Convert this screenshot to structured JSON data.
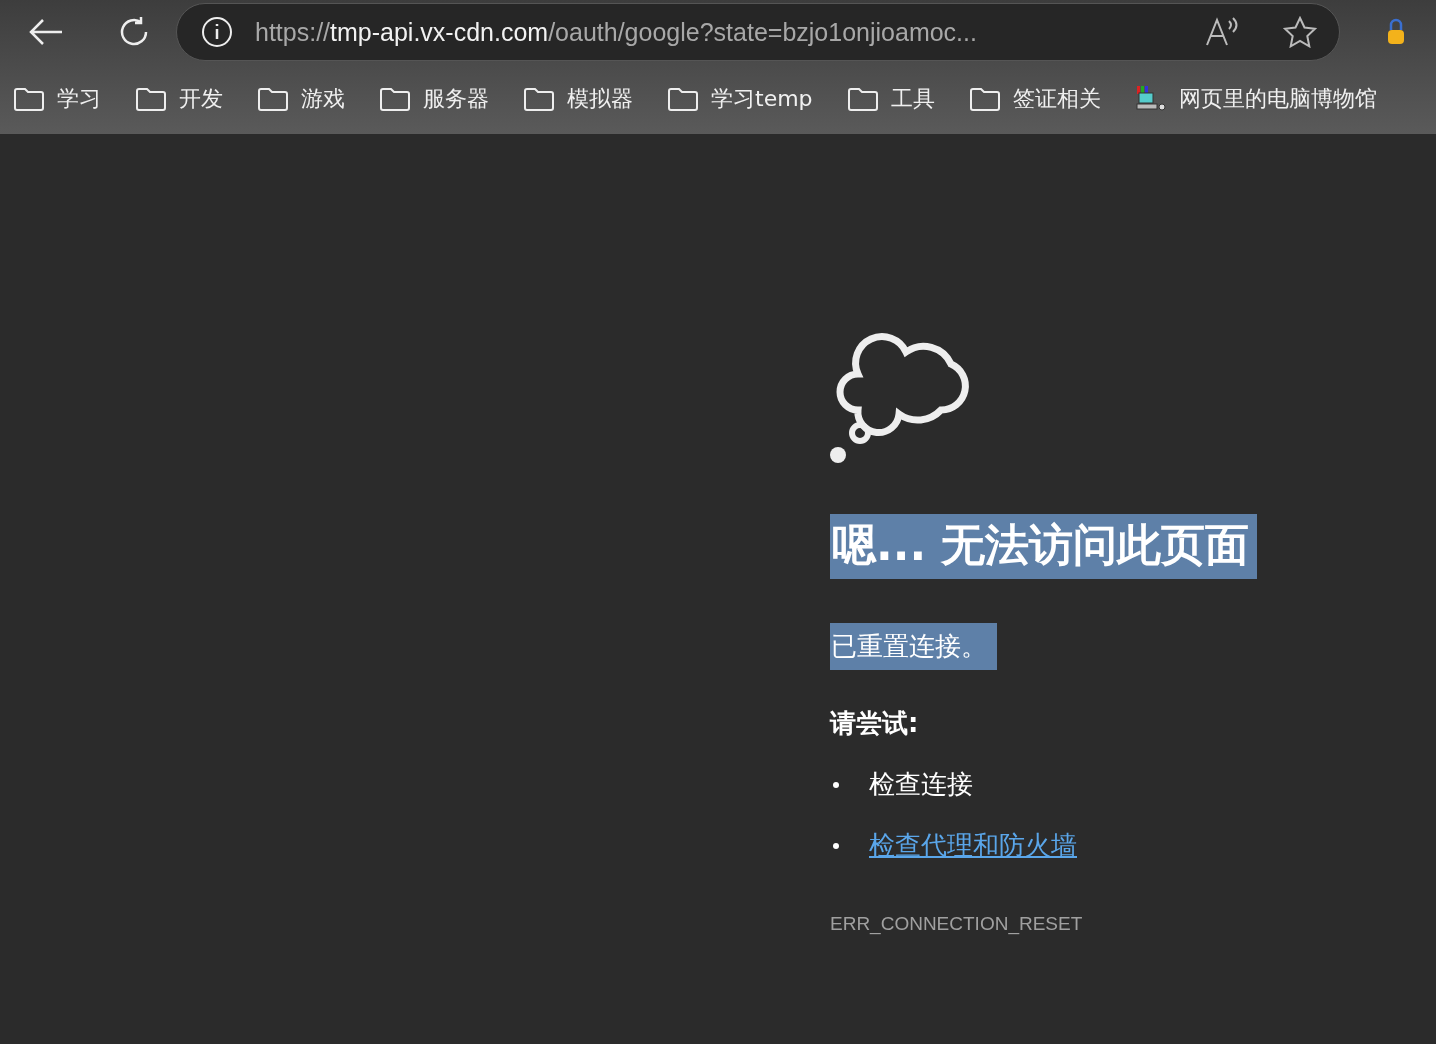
{
  "address": {
    "scheme": "https://",
    "host": "tmp-api.vx-cdn.com",
    "path": "/oauth/google?state=bzjo1onjioamoc..."
  },
  "bookmarks": [
    {
      "kind": "folder",
      "label": "学习"
    },
    {
      "kind": "folder",
      "label": "开发"
    },
    {
      "kind": "folder",
      "label": "游戏"
    },
    {
      "kind": "folder",
      "label": "服务器"
    },
    {
      "kind": "folder",
      "label": "模拟器"
    },
    {
      "kind": "folder",
      "label": "学习temp"
    },
    {
      "kind": "folder",
      "label": "工具"
    },
    {
      "kind": "folder",
      "label": "签证相关"
    },
    {
      "kind": "site",
      "label": "网页里的电脑博物馆"
    }
  ],
  "error": {
    "heading": "嗯... 无法访问此页面",
    "heading_selected": true,
    "message": "已重置连接。",
    "message_selected": true,
    "try_label": "请尝试:",
    "suggestions": [
      {
        "kind": "text",
        "label": "检查连接"
      },
      {
        "kind": "link",
        "label": "检查代理和防火墙"
      }
    ],
    "code": "ERR_CONNECTION_RESET"
  }
}
